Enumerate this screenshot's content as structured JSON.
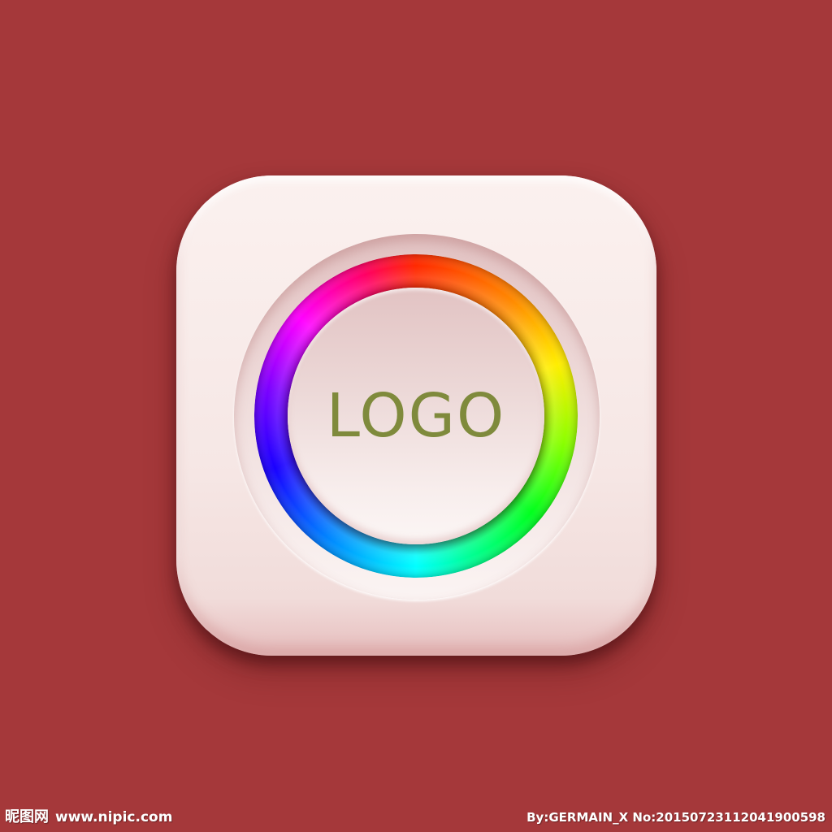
{
  "icon": {
    "logo_text": "LOGO",
    "name": "app-icon-rainbow-ring"
  },
  "watermark": {
    "site_name": "昵图网",
    "site_url": "www.nipic.com",
    "credit": "By:GERMAIN_X No:20150723112041900598"
  },
  "colors": {
    "background": "#a5383a",
    "tile": "#f6e7e5",
    "logo_text": "#7f8a3c",
    "ring_spectrum": [
      "#ff0000",
      "#ffff00",
      "#00ff00",
      "#00ffff",
      "#0000ff",
      "#ff00ff"
    ]
  }
}
